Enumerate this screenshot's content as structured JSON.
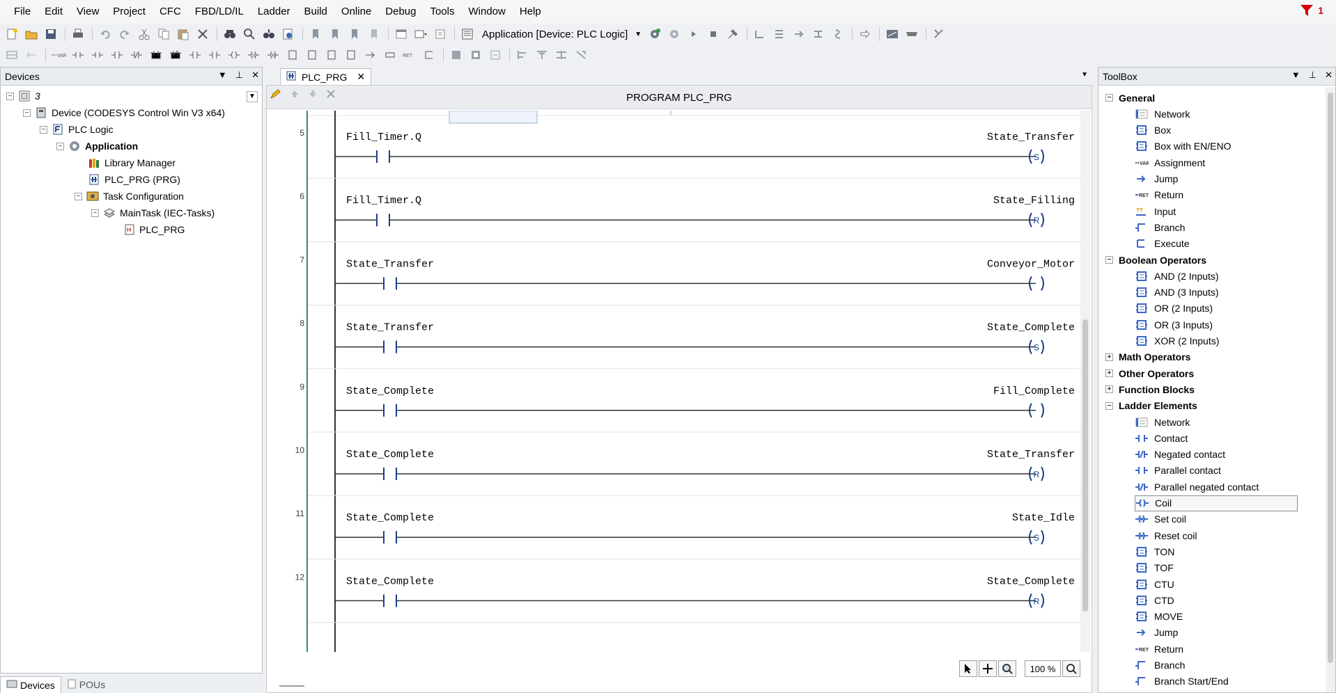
{
  "menu": [
    "File",
    "Edit",
    "View",
    "Project",
    "CFC",
    "FBD/LD/IL",
    "Ladder",
    "Build",
    "Online",
    "Debug",
    "Tools",
    "Window",
    "Help"
  ],
  "alert": {
    "count": "1",
    "color": "#d00000"
  },
  "toolbar": {
    "app_selector": "Application [Device: PLC Logic]"
  },
  "devices": {
    "title": "Devices",
    "tree": [
      {
        "label": "3",
        "icon": "project-icon",
        "italic": true
      },
      {
        "label": "Device (CODESYS Control Win V3 x64)",
        "icon": "device-icon"
      },
      {
        "label": "PLC Logic",
        "icon": "plc-logic-icon"
      },
      {
        "label": "Application",
        "icon": "application-icon",
        "bold": true
      },
      {
        "label": "Library Manager",
        "icon": "library-icon"
      },
      {
        "label": "PLC_PRG (PRG)",
        "icon": "pou-icon"
      },
      {
        "label": "Task Configuration",
        "icon": "task-config-icon"
      },
      {
        "label": "MainTask (IEC-Tasks)",
        "icon": "task-icon"
      },
      {
        "label": "PLC_PRG",
        "icon": "pou-call-icon"
      }
    ],
    "bottom_tabs": [
      "Devices",
      "POUs"
    ]
  },
  "editor": {
    "tab_label": "PLC_PRG",
    "title": "PROGRAM PLC_PRG",
    "zoom": "100 %",
    "rungs": [
      {
        "number": "5",
        "contact": "Fill_Timer.Q",
        "coil": "State_Transfer",
        "coil_type": "S"
      },
      {
        "number": "6",
        "contact": "Fill_Timer.Q",
        "coil": "State_Filling",
        "coil_type": "R"
      },
      {
        "number": "7",
        "contact": "State_Transfer",
        "coil": "Conveyor_Motor",
        "coil_type": ""
      },
      {
        "number": "8",
        "contact": "State_Transfer",
        "coil": "State_Complete",
        "coil_type": "S"
      },
      {
        "number": "9",
        "contact": "State_Complete",
        "coil": "Fill_Complete",
        "coil_type": ""
      },
      {
        "number": "10",
        "contact": "State_Complete",
        "coil": "State_Transfer",
        "coil_type": "R"
      },
      {
        "number": "11",
        "contact": "State_Complete",
        "coil": "State_Idle",
        "coil_type": "S"
      },
      {
        "number": "12",
        "contact": "State_Complete",
        "coil": "State_Complete",
        "coil_type": "R"
      }
    ]
  },
  "toolbox": {
    "title": "ToolBox",
    "categories": [
      {
        "name": "General",
        "expanded": true,
        "items": [
          "Network",
          "Box",
          "Box with EN/ENO",
          "Assignment",
          "Jump",
          "Return",
          "Input",
          "Branch",
          "Execute"
        ]
      },
      {
        "name": "Boolean Operators",
        "expanded": true,
        "items": [
          "AND (2 Inputs)",
          "AND (3 Inputs)",
          "OR (2 Inputs)",
          "OR (3 Inputs)",
          "XOR (2 Inputs)"
        ]
      },
      {
        "name": "Math Operators",
        "expanded": false,
        "items": []
      },
      {
        "name": "Other Operators",
        "expanded": false,
        "items": []
      },
      {
        "name": "Function Blocks",
        "expanded": false,
        "items": []
      },
      {
        "name": "Ladder Elements",
        "expanded": true,
        "items": [
          "Network",
          "Contact",
          "Negated contact",
          "Parallel contact",
          "Parallel negated contact",
          "Coil",
          "Set coil",
          "Reset coil",
          "TON",
          "TOF",
          "CTU",
          "CTD",
          "MOVE",
          "Jump",
          "Return",
          "Branch",
          "Branch Start/End"
        ]
      }
    ],
    "selected_item": "Coil"
  }
}
